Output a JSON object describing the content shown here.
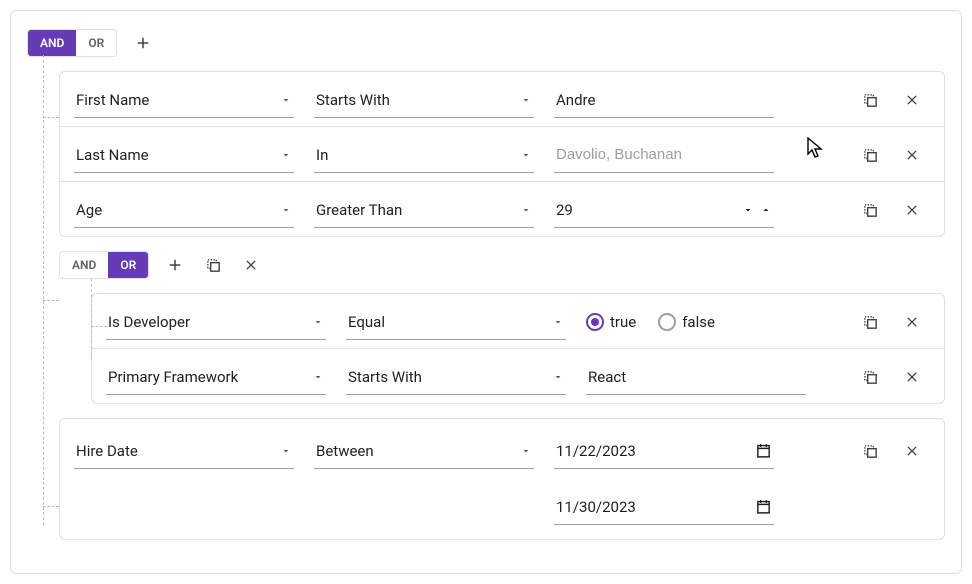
{
  "toggle": {
    "and": "AND",
    "or": "OR"
  },
  "rules": [
    {
      "field": "First Name",
      "op": "Starts With",
      "value": "Andre"
    },
    {
      "field": "Last Name",
      "op": "In",
      "placeholder": "Davolio, Buchanan"
    },
    {
      "field": "Age",
      "op": "Greater Than",
      "value": "29"
    }
  ],
  "nested": {
    "active": "or",
    "rules": [
      {
        "field": "Is Developer",
        "op": "Equal",
        "radio": {
          "true": "true",
          "false": "false",
          "selected": "true"
        }
      },
      {
        "field": "Primary Framework",
        "op": "Starts With",
        "value": "React"
      }
    ]
  },
  "dateRule": {
    "field": "Hire Date",
    "op": "Between",
    "start": "11/22/2023",
    "end": "11/30/2023"
  }
}
